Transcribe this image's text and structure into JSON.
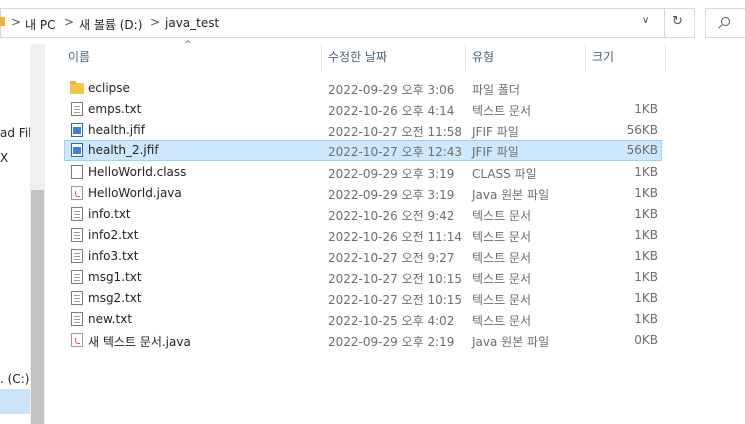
{
  "address": {
    "crumbs": [
      "내 PC",
      "새 볼륨 (D:)",
      "java_test"
    ],
    "separator": ">",
    "dropdown_glyph": "∨",
    "refresh_glyph": "↻"
  },
  "nav": {
    "items": [
      "ad File",
      "X",
      ". (C:)"
    ]
  },
  "columns": {
    "name": "이름",
    "date": "수정한 날짜",
    "type": "유형",
    "size": "크기",
    "sort_glyph": "^"
  },
  "files": [
    {
      "name": "eclipse",
      "date": "2022-09-29 오후 3:06",
      "type": "파일 폴더",
      "size": "",
      "icon": "folder-icon"
    },
    {
      "name": "emps.txt",
      "date": "2022-10-26 오후 4:14",
      "type": "텍스트 문서",
      "size": "1KB",
      "icon": "text-file-icon"
    },
    {
      "name": "health.jfif",
      "date": "2022-10-27 오전 11:58",
      "type": "JFIF 파일",
      "size": "56KB",
      "icon": "image-file-icon"
    },
    {
      "name": "health_2.jfif",
      "date": "2022-10-27 오후 12:43",
      "type": "JFIF 파일",
      "size": "56KB",
      "icon": "image-file-icon",
      "selected": true
    },
    {
      "name": "HelloWorld.class",
      "date": "2022-09-29 오후 3:19",
      "type": "CLASS 파일",
      "size": "1KB",
      "icon": "blank-file-icon"
    },
    {
      "name": "HelloWorld.java",
      "date": "2022-09-29 오후 3:19",
      "type": "Java 원본 파일",
      "size": "1KB",
      "icon": "java-file-icon"
    },
    {
      "name": "info.txt",
      "date": "2022-10-26 오전 9:42",
      "type": "텍스트 문서",
      "size": "1KB",
      "icon": "text-file-icon"
    },
    {
      "name": "info2.txt",
      "date": "2022-10-26 오전 11:14",
      "type": "텍스트 문서",
      "size": "1KB",
      "icon": "text-file-icon"
    },
    {
      "name": "info3.txt",
      "date": "2022-10-27 오전 9:27",
      "type": "텍스트 문서",
      "size": "1KB",
      "icon": "text-file-icon"
    },
    {
      "name": "msg1.txt",
      "date": "2022-10-27 오전 10:15",
      "type": "텍스트 문서",
      "size": "1KB",
      "icon": "text-file-icon"
    },
    {
      "name": "msg2.txt",
      "date": "2022-10-27 오전 10:15",
      "type": "텍스트 문서",
      "size": "1KB",
      "icon": "text-file-icon"
    },
    {
      "name": "new.txt",
      "date": "2022-10-25 오후 4:02",
      "type": "텍스트 문서",
      "size": "1KB",
      "icon": "text-file-icon"
    },
    {
      "name": "새 텍스트 문서.java",
      "date": "2022-09-29 오후 2:19",
      "type": "Java 원본 파일",
      "size": "0KB",
      "icon": "java-file-icon"
    }
  ]
}
